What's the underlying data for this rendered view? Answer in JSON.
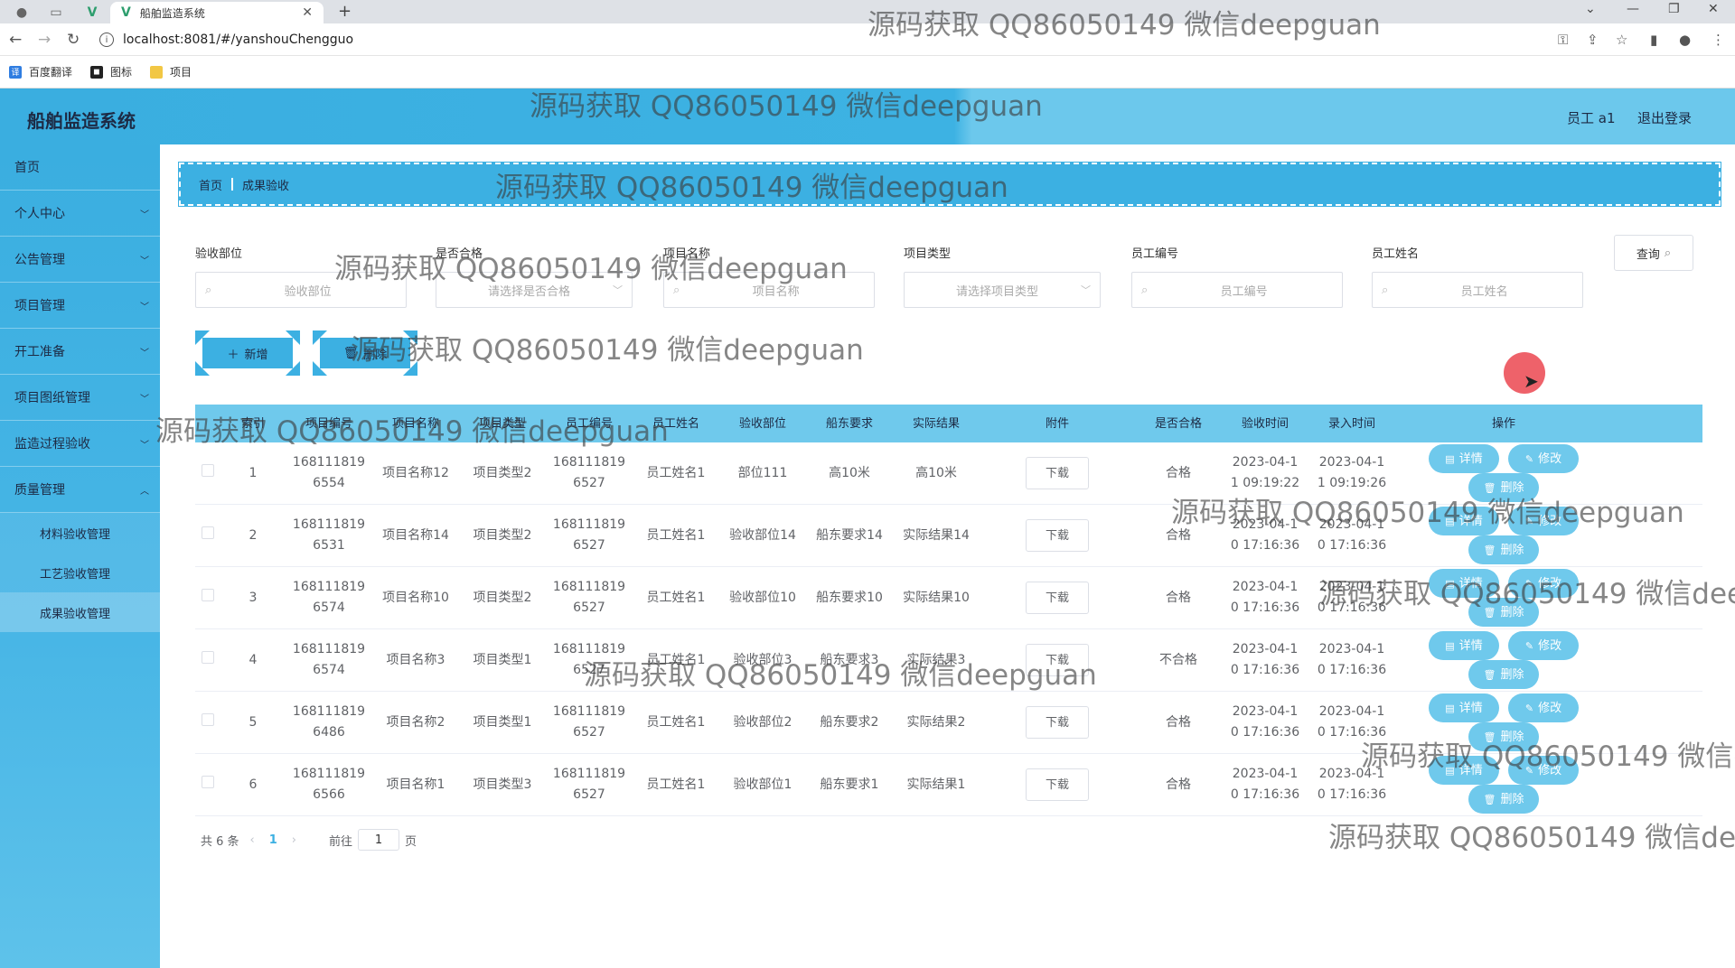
{
  "browser": {
    "tab_title": "船舶监造系统",
    "url": "localhost:8081/#/yanshouChengguo",
    "bookmarks": [
      "百度翻译",
      "图标",
      "项目"
    ]
  },
  "header": {
    "brand": "船舶监造系统",
    "user": "员工 a1",
    "logout": "退出登录"
  },
  "sidebar": {
    "items": [
      {
        "label": "首页"
      },
      {
        "label": "个人中心"
      },
      {
        "label": "公告管理"
      },
      {
        "label": "项目管理"
      },
      {
        "label": "开工准备"
      },
      {
        "label": "项目图纸管理"
      },
      {
        "label": "监造过程验收"
      },
      {
        "label": "质量管理"
      }
    ],
    "sub_items": [
      "材料验收管理",
      "工艺验收管理",
      "成果验收管理"
    ]
  },
  "breadcrumb": {
    "home": "首页",
    "current": "成果验收"
  },
  "filters": {
    "f1": {
      "label": "验收部位",
      "placeholder": "验收部位"
    },
    "f2": {
      "label": "是否合格",
      "placeholder": "请选择是否合格"
    },
    "f3": {
      "label": "项目名称",
      "placeholder": "项目名称"
    },
    "f4": {
      "label": "项目类型",
      "placeholder": "请选择项目类型"
    },
    "f5": {
      "label": "员工编号",
      "placeholder": "员工编号"
    },
    "f6": {
      "label": "员工姓名",
      "placeholder": "员工姓名"
    },
    "query": "查询"
  },
  "actions": {
    "add": "新增",
    "delete": "删除"
  },
  "table": {
    "columns": [
      "索引",
      "项目编号",
      "项目名称",
      "项目类型",
      "员工编号",
      "员工姓名",
      "验收部位",
      "船东要求",
      "实际结果",
      "附件",
      "是否合格",
      "验收时间",
      "录入时间",
      "操作"
    ],
    "download": "下载",
    "ops": {
      "detail": "详情",
      "edit": "修改",
      "delete": "删除"
    },
    "rows": [
      {
        "idx": "1",
        "pno": [
          "168111819",
          "6554"
        ],
        "pname": "项目名称12",
        "ptype": "项目类型2",
        "eno": [
          "168111819",
          "6527"
        ],
        "ename": "员工姓名1",
        "part": "部位111",
        "req": "高10米",
        "res": "高10米",
        "pass": "合格",
        "ytime": [
          "2023-04-1",
          "1 09:19:22"
        ],
        "rtime": [
          "2023-04-1",
          "1 09:19:26"
        ]
      },
      {
        "idx": "2",
        "pno": [
          "168111819",
          "6531"
        ],
        "pname": "项目名称14",
        "ptype": "项目类型2",
        "eno": [
          "168111819",
          "6527"
        ],
        "ename": "员工姓名1",
        "part": "验收部位14",
        "req": "船东要求14",
        "res": "实际结果14",
        "pass": "合格",
        "ytime": [
          "2023-04-1",
          "0 17:16:36"
        ],
        "rtime": [
          "2023-04-1",
          "0 17:16:36"
        ]
      },
      {
        "idx": "3",
        "pno": [
          "168111819",
          "6574"
        ],
        "pname": "项目名称10",
        "ptype": "项目类型2",
        "eno": [
          "168111819",
          "6527"
        ],
        "ename": "员工姓名1",
        "part": "验收部位10",
        "req": "船东要求10",
        "res": "实际结果10",
        "pass": "合格",
        "ytime": [
          "2023-04-1",
          "0 17:16:36"
        ],
        "rtime": [
          "2023-04-1",
          "0 17:16:36"
        ]
      },
      {
        "idx": "4",
        "pno": [
          "168111819",
          "6574"
        ],
        "pname": "项目名称3",
        "ptype": "项目类型1",
        "eno": [
          "168111819",
          "6527"
        ],
        "ename": "员工姓名1",
        "part": "验收部位3",
        "req": "船东要求3",
        "res": "实际结果3",
        "pass": "不合格",
        "ytime": [
          "2023-04-1",
          "0 17:16:36"
        ],
        "rtime": [
          "2023-04-1",
          "0 17:16:36"
        ]
      },
      {
        "idx": "5",
        "pno": [
          "168111819",
          "6486"
        ],
        "pname": "项目名称2",
        "ptype": "项目类型1",
        "eno": [
          "168111819",
          "6527"
        ],
        "ename": "员工姓名1",
        "part": "验收部位2",
        "req": "船东要求2",
        "res": "实际结果2",
        "pass": "合格",
        "ytime": [
          "2023-04-1",
          "0 17:16:36"
        ],
        "rtime": [
          "2023-04-1",
          "0 17:16:36"
        ]
      },
      {
        "idx": "6",
        "pno": [
          "168111819",
          "6566"
        ],
        "pname": "项目名称1",
        "ptype": "项目类型3",
        "eno": [
          "168111819",
          "6527"
        ],
        "ename": "员工姓名1",
        "part": "验收部位1",
        "req": "船东要求1",
        "res": "实际结果1",
        "pass": "合格",
        "ytime": [
          "2023-04-1",
          "0 17:16:36"
        ],
        "rtime": [
          "2023-04-1",
          "0 17:16:36"
        ]
      }
    ]
  },
  "pager": {
    "total": "共 6 条",
    "page": "1",
    "goto": "前往",
    "input": "1",
    "unit": "页"
  },
  "watermark": "源码获取 QQ86050149 微信deepguan"
}
